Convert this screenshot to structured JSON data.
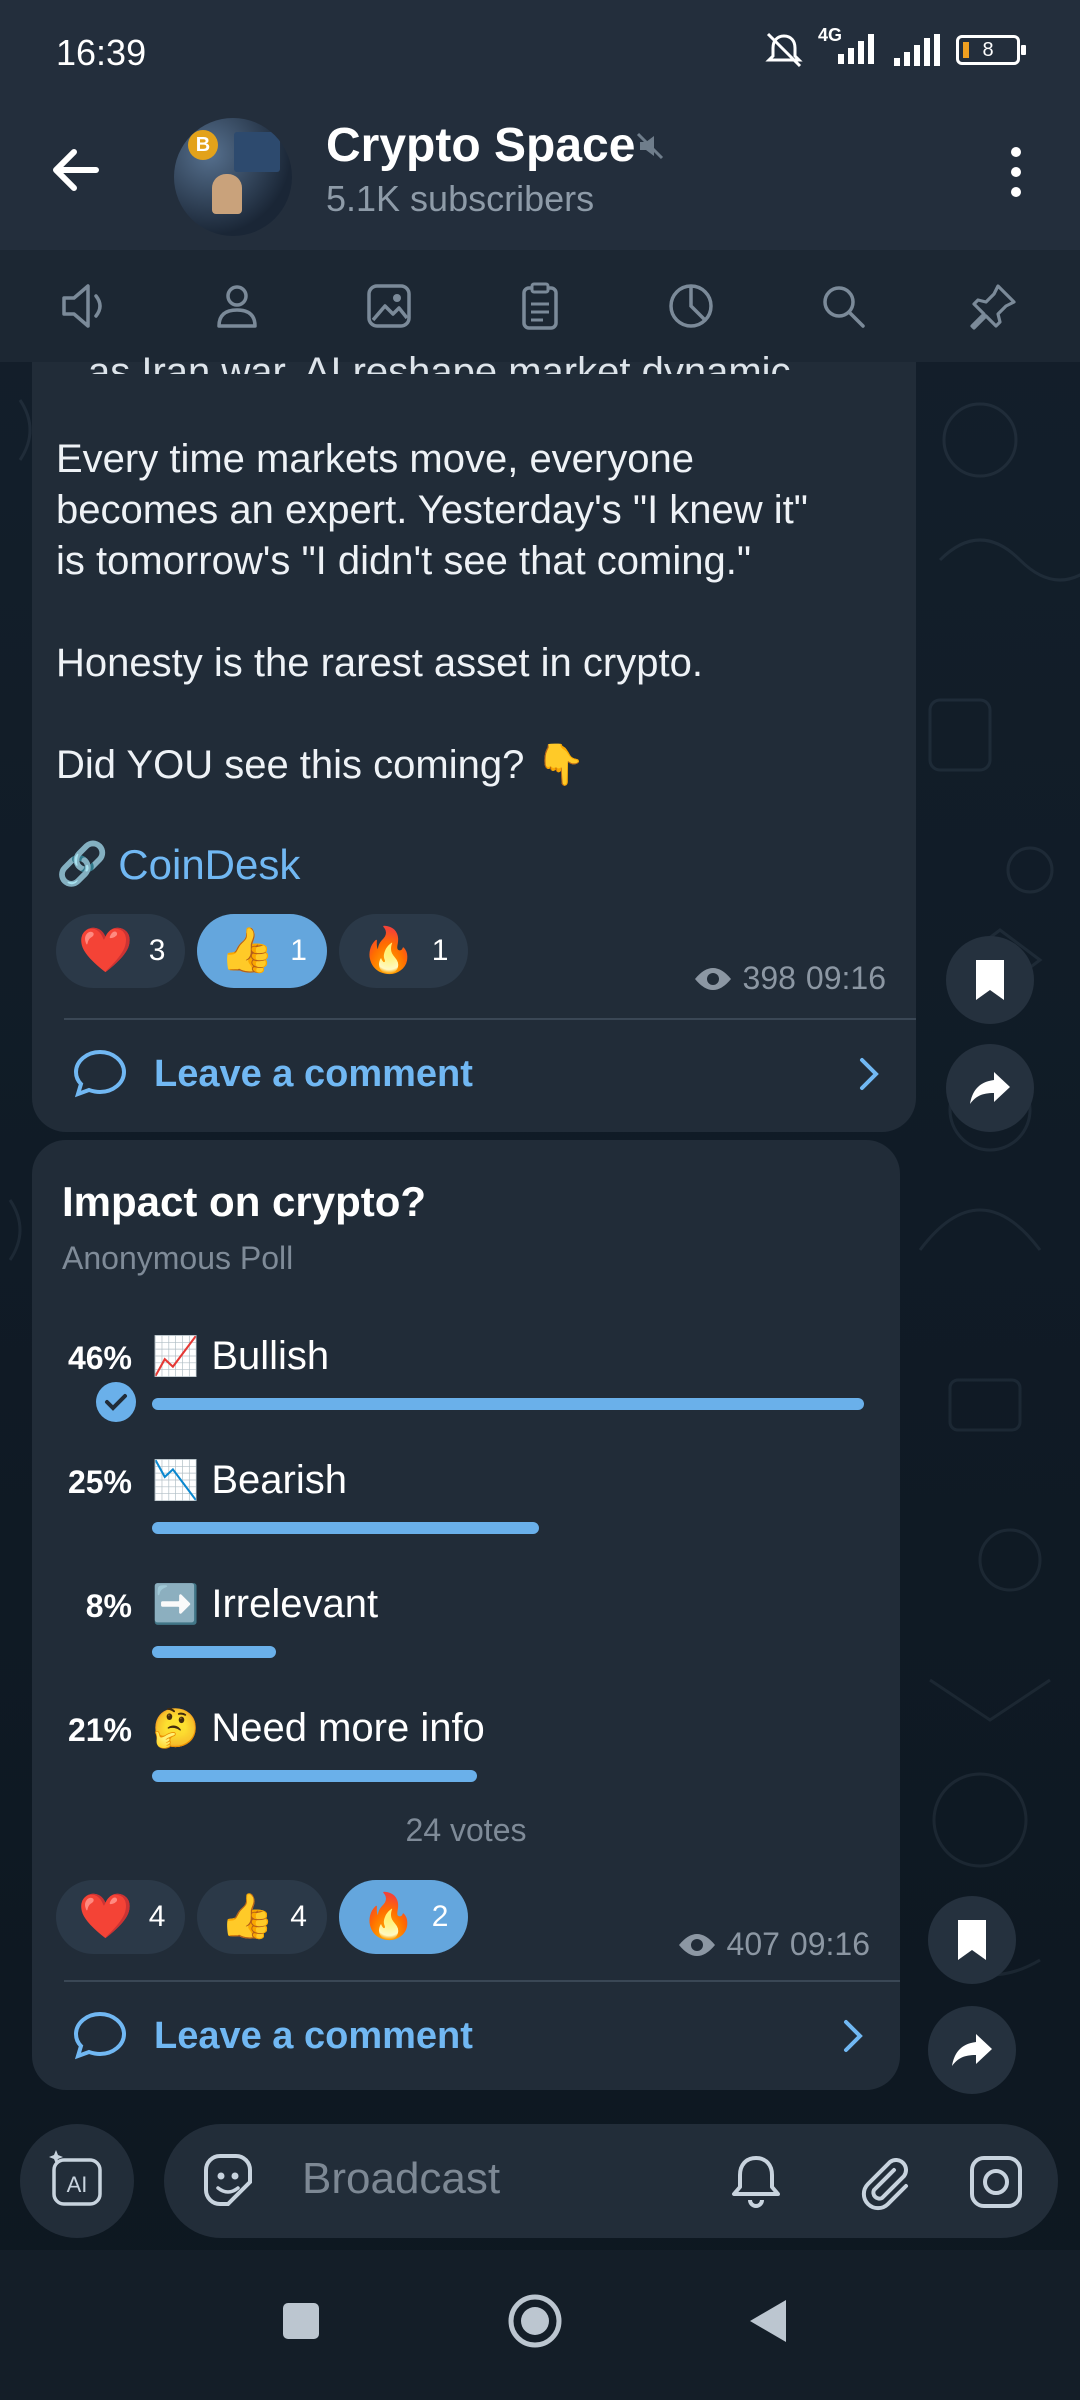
{
  "status_bar": {
    "time": "16:39",
    "network": "4G",
    "battery": "8"
  },
  "header": {
    "channel_name": "Crypto Space",
    "subscribers": "5.1K subscribers",
    "avatar_coin": "B"
  },
  "tabs": [
    "audio-icon",
    "members-icon",
    "media-icon",
    "files-icon",
    "stats-icon",
    "search-icon",
    "pin-icon"
  ],
  "message1": {
    "cut_line": "as Iran war, AI reshape market dynamic",
    "text": "Every time markets move, everyone\nbecomes an expert. Yesterday's \"I knew it\"\nis tomorrow's \"I didn't see that coming.\"\n\nHonesty is the rarest asset in crypto.\n\nDid YOU see this coming? 👇",
    "link_text": "CoinDesk",
    "link_emoji": "🔗",
    "reactions": [
      {
        "emoji": "❤️",
        "count": "3",
        "active": false
      },
      {
        "emoji": "👍",
        "count": "1",
        "active": true
      },
      {
        "emoji": "🔥",
        "count": "1",
        "active": false
      }
    ],
    "views": "398",
    "time": "09:16",
    "comment_label": "Leave a comment"
  },
  "message2": {
    "poll_question": "Impact on crypto?",
    "poll_type": "Anonymous Poll",
    "options": [
      {
        "percent": "46%",
        "emoji": "📈",
        "label": "Bullish",
        "value": 46,
        "chosen": true
      },
      {
        "percent": "25%",
        "emoji": "📉",
        "label": "Bearish",
        "value": 25,
        "chosen": false
      },
      {
        "percent": "8%",
        "emoji": "➡️",
        "label": "Irrelevant",
        "value": 8,
        "chosen": false
      },
      {
        "percent": "21%",
        "emoji": "🤔",
        "label": "Need more info",
        "value": 21,
        "chosen": false
      }
    ],
    "votes": "24 votes",
    "reactions": [
      {
        "emoji": "❤️",
        "count": "4",
        "active": false
      },
      {
        "emoji": "👍",
        "count": "4",
        "active": false
      },
      {
        "emoji": "🔥",
        "count": "2",
        "active": true
      }
    ],
    "views": "407",
    "time": "09:16",
    "comment_label": "Leave a comment"
  },
  "input": {
    "placeholder": "Broadcast"
  },
  "colors": {
    "accent": "#71b8f3",
    "bubble": "#212c38",
    "header": "#232e3c",
    "reaction_active": "#64a6dd",
    "poll_bar": "#6ab0ea"
  }
}
